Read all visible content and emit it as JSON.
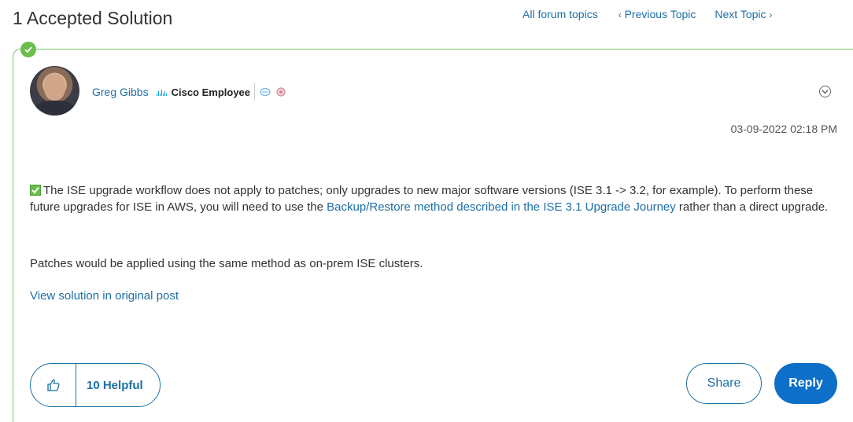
{
  "header": {
    "title": "1 Accepted Solution",
    "nav": {
      "all_topics": "All forum topics",
      "previous": "Previous Topic",
      "next": "Next Topic",
      "prev_chevron": "‹",
      "next_chevron": "›"
    }
  },
  "post": {
    "author": "Greg Gibbs",
    "role": "Cisco Employee",
    "timestamp": "03-09-2022 02:18 PM",
    "body": {
      "lead": "The ISE upgrade workflow does not apply to patches; only upgrades to new major software versions (ISE 3.1 -> 3.2, for example). To perform these future upgrades for ISE in AWS, you will need to use the ",
      "link": "Backup/Restore method described in the ISE 3.1 Upgrade Journey",
      "tail": " rather than a direct upgrade.",
      "para2": "Patches would be applied using the same method as on-prem ISE clusters."
    },
    "view_solution": "View solution in original post"
  },
  "actions": {
    "helpful": "10 Helpful",
    "share": "Share",
    "reply": "Reply"
  },
  "colors": {
    "accent": "#1d6fa5",
    "success": "#6abf4b",
    "reply_bg": "#0d6fc8"
  },
  "icons": [
    "check-circle-icon",
    "cisco-logo-icon",
    "community-badge-icon",
    "award-badge-icon",
    "options-chevron-icon",
    "checkbox-icon",
    "thumbs-up-icon"
  ]
}
